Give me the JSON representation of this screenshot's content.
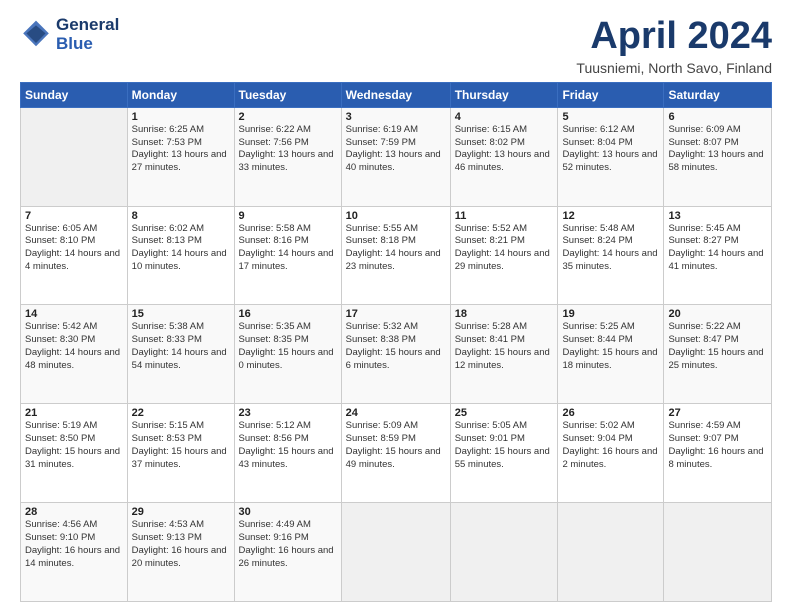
{
  "logo": {
    "line1": "General",
    "line2": "Blue"
  },
  "title": "April 2024",
  "subtitle": "Tuusniemi, North Savo, Finland",
  "days_header": [
    "Sunday",
    "Monday",
    "Tuesday",
    "Wednesday",
    "Thursday",
    "Friday",
    "Saturday"
  ],
  "weeks": [
    [
      {
        "day": "",
        "empty": true
      },
      {
        "day": "1",
        "sunrise": "6:25 AM",
        "sunset": "7:53 PM",
        "daylight": "13 hours and 27 minutes."
      },
      {
        "day": "2",
        "sunrise": "6:22 AM",
        "sunset": "7:56 PM",
        "daylight": "13 hours and 33 minutes."
      },
      {
        "day": "3",
        "sunrise": "6:19 AM",
        "sunset": "7:59 PM",
        "daylight": "13 hours and 40 minutes."
      },
      {
        "day": "4",
        "sunrise": "6:15 AM",
        "sunset": "8:02 PM",
        "daylight": "13 hours and 46 minutes."
      },
      {
        "day": "5",
        "sunrise": "6:12 AM",
        "sunset": "8:04 PM",
        "daylight": "13 hours and 52 minutes."
      },
      {
        "day": "6",
        "sunrise": "6:09 AM",
        "sunset": "8:07 PM",
        "daylight": "13 hours and 58 minutes."
      }
    ],
    [
      {
        "day": "7",
        "sunrise": "6:05 AM",
        "sunset": "8:10 PM",
        "daylight": "14 hours and 4 minutes."
      },
      {
        "day": "8",
        "sunrise": "6:02 AM",
        "sunset": "8:13 PM",
        "daylight": "14 hours and 10 minutes."
      },
      {
        "day": "9",
        "sunrise": "5:58 AM",
        "sunset": "8:16 PM",
        "daylight": "14 hours and 17 minutes."
      },
      {
        "day": "10",
        "sunrise": "5:55 AM",
        "sunset": "8:18 PM",
        "daylight": "14 hours and 23 minutes."
      },
      {
        "day": "11",
        "sunrise": "5:52 AM",
        "sunset": "8:21 PM",
        "daylight": "14 hours and 29 minutes."
      },
      {
        "day": "12",
        "sunrise": "5:48 AM",
        "sunset": "8:24 PM",
        "daylight": "14 hours and 35 minutes."
      },
      {
        "day": "13",
        "sunrise": "5:45 AM",
        "sunset": "8:27 PM",
        "daylight": "14 hours and 41 minutes."
      }
    ],
    [
      {
        "day": "14",
        "sunrise": "5:42 AM",
        "sunset": "8:30 PM",
        "daylight": "14 hours and 48 minutes."
      },
      {
        "day": "15",
        "sunrise": "5:38 AM",
        "sunset": "8:33 PM",
        "daylight": "14 hours and 54 minutes."
      },
      {
        "day": "16",
        "sunrise": "5:35 AM",
        "sunset": "8:35 PM",
        "daylight": "15 hours and 0 minutes."
      },
      {
        "day": "17",
        "sunrise": "5:32 AM",
        "sunset": "8:38 PM",
        "daylight": "15 hours and 6 minutes."
      },
      {
        "day": "18",
        "sunrise": "5:28 AM",
        "sunset": "8:41 PM",
        "daylight": "15 hours and 12 minutes."
      },
      {
        "day": "19",
        "sunrise": "5:25 AM",
        "sunset": "8:44 PM",
        "daylight": "15 hours and 18 minutes."
      },
      {
        "day": "20",
        "sunrise": "5:22 AM",
        "sunset": "8:47 PM",
        "daylight": "15 hours and 25 minutes."
      }
    ],
    [
      {
        "day": "21",
        "sunrise": "5:19 AM",
        "sunset": "8:50 PM",
        "daylight": "15 hours and 31 minutes."
      },
      {
        "day": "22",
        "sunrise": "5:15 AM",
        "sunset": "8:53 PM",
        "daylight": "15 hours and 37 minutes."
      },
      {
        "day": "23",
        "sunrise": "5:12 AM",
        "sunset": "8:56 PM",
        "daylight": "15 hours and 43 minutes."
      },
      {
        "day": "24",
        "sunrise": "5:09 AM",
        "sunset": "8:59 PM",
        "daylight": "15 hours and 49 minutes."
      },
      {
        "day": "25",
        "sunrise": "5:05 AM",
        "sunset": "9:01 PM",
        "daylight": "15 hours and 55 minutes."
      },
      {
        "day": "26",
        "sunrise": "5:02 AM",
        "sunset": "9:04 PM",
        "daylight": "16 hours and 2 minutes."
      },
      {
        "day": "27",
        "sunrise": "4:59 AM",
        "sunset": "9:07 PM",
        "daylight": "16 hours and 8 minutes."
      }
    ],
    [
      {
        "day": "28",
        "sunrise": "4:56 AM",
        "sunset": "9:10 PM",
        "daylight": "16 hours and 14 minutes."
      },
      {
        "day": "29",
        "sunrise": "4:53 AM",
        "sunset": "9:13 PM",
        "daylight": "16 hours and 20 minutes."
      },
      {
        "day": "30",
        "sunrise": "4:49 AM",
        "sunset": "9:16 PM",
        "daylight": "16 hours and 26 minutes."
      },
      {
        "day": "",
        "empty": true
      },
      {
        "day": "",
        "empty": true
      },
      {
        "day": "",
        "empty": true
      },
      {
        "day": "",
        "empty": true
      }
    ]
  ]
}
